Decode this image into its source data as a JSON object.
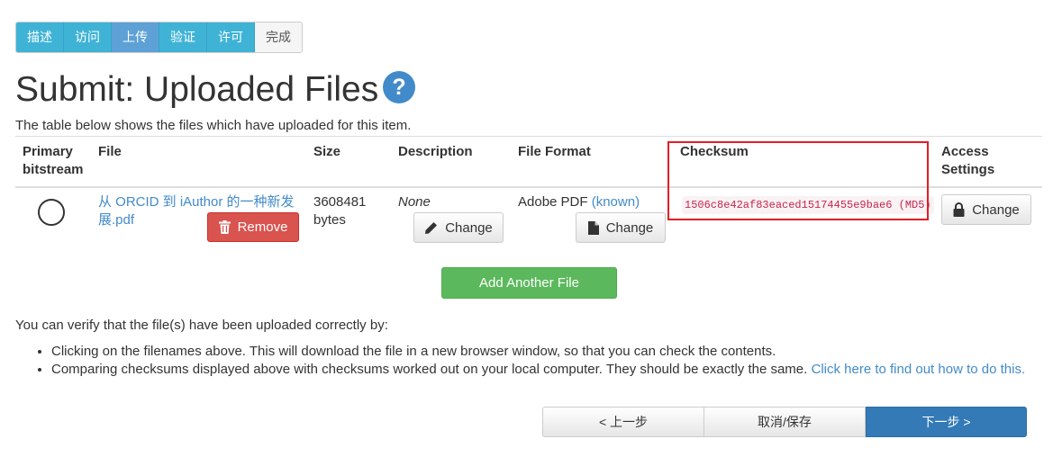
{
  "steps": [
    {
      "label": "描述",
      "state": "done"
    },
    {
      "label": "访问",
      "state": "done"
    },
    {
      "label": "上传",
      "state": "current"
    },
    {
      "label": "验证",
      "state": "done"
    },
    {
      "label": "许可",
      "state": "done"
    },
    {
      "label": "完成",
      "state": "todo"
    }
  ],
  "page_title": "Submit: Uploaded Files",
  "help_icon_glyph": "?",
  "intro_text": "The table below shows the files which have uploaded for this item.",
  "table": {
    "headers": {
      "primary_line1": "Primary",
      "primary_line2": "bitstream",
      "file": "File",
      "size": "Size",
      "description": "Description",
      "file_format": "File Format",
      "checksum": "Checksum",
      "access_line1": "Access",
      "access_line2": "Settings"
    },
    "rows": [
      {
        "file_name_line1": "从 ORCID 到 iAuthor 的一种新发",
        "file_name_line2": "展.pdf",
        "remove_label": "Remove",
        "size_line1": "3608481",
        "size_line2": "bytes",
        "description": "None",
        "description_change_label": "Change",
        "format": "Adobe PDF",
        "format_known": "(known)",
        "format_change_label": "Change",
        "checksum": "1506c8e42af83eaced15174455e9bae6 (MD5)",
        "access_change_label": "Change"
      }
    ]
  },
  "add_file_label": "Add Another File",
  "verify_text": "You can verify that the file(s) have been uploaded correctly by:",
  "bullets": {
    "item1": "Clicking on the filenames above. This will download the file in a new browser window, so that you can check the contents.",
    "item2": "Comparing checksums displayed above with checksums worked out on your local computer. They should be exactly the same.",
    "item2_link": "Click here to find out how to do this."
  },
  "nav": {
    "prev_label": "< 上一步",
    "cancel_label": "取消/保存",
    "next_label": "下一步 >"
  },
  "icons": {
    "trash": "trash-icon",
    "pencil": "pencil-icon",
    "file": "file-icon",
    "lock": "lock-icon",
    "help": "question-circle-icon"
  },
  "colors": {
    "step_done": "#3fb3d6",
    "step_current": "#5ea1d6",
    "link": "#428bca",
    "danger": "#d9534f",
    "success": "#5cb85c",
    "primary": "#337ab7",
    "highlight": "#e31e24"
  }
}
